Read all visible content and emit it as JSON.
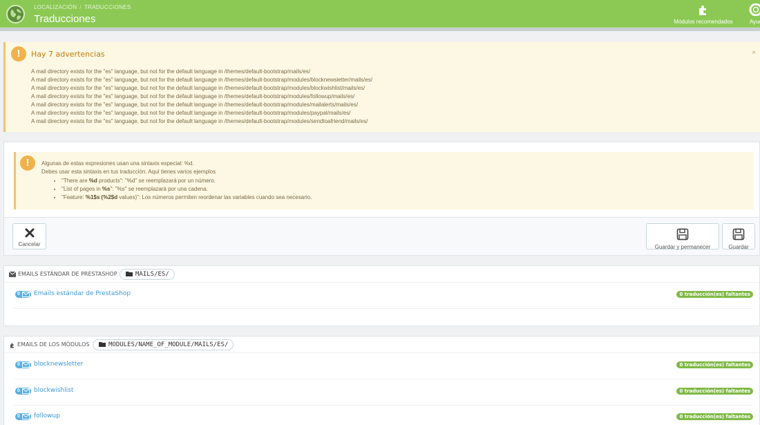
{
  "header": {
    "breadcrumb": [
      "LOCALIZACIÓN",
      "TRADUCCIONES"
    ],
    "breadcrumb_sep": "/",
    "title": "Traducciones",
    "actions": [
      {
        "label": "Módulos recomendados",
        "icon": "puzzle-icon"
      },
      {
        "label": "Ayud",
        "icon": "lifebuoy-icon"
      }
    ]
  },
  "warnings": {
    "title": "Hay 7 advertencias",
    "close": "×",
    "items": [
      "A mail directory exists for the \"es\" language, but not for the default language in /themes/default-bootstrap/mails/es/",
      "A mail directory exists for the \"es\" language, but not for the default language in /themes/default-bootstrap/modules/blocknewsletter/mails/es/",
      "A mail directory exists for the \"es\" language, but not for the default language in /themes/default-bootstrap/modules/blockwishlist/mails/es/",
      "A mail directory exists for the \"es\" language, but not for the default language in /themes/default-bootstrap/modules/followup/mails/es/",
      "A mail directory exists for the \"es\" language, but not for the default language in /themes/default-bootstrap/modules/mailalerts/mails/es/",
      "A mail directory exists for the \"es\" language, but not for the default language in /themes/default-bootstrap/modules/paypal/mails/es/",
      "A mail directory exists for the \"es\" language, but not for the default language in /themes/default-bootstrap/modules/sendtoafriend/mails/es/"
    ]
  },
  "info": {
    "line1": "Algunas de estas expresiones usan una sintaxis especial: %d.",
    "line2": "Debes usar esta sintaxis en tus traducción. Aquí tienes varios ejemplos",
    "examples": [
      {
        "pre": "\"There are ",
        "bold": "%d",
        "post": " products\": \"%d\" se reemplazará por un número."
      },
      {
        "pre": "\"List of pages in ",
        "bold": "%s",
        "post": "\": \"%s\" se reemplazará por una cadena."
      },
      {
        "pre": "\"Feature: ",
        "bold": "%1$s (%2$d",
        "post": " values)\": Los números permiten reordenar las variables cuando sea necesario."
      }
    ]
  },
  "toolbar": {
    "cancel": "Cancelar",
    "save_stay": "Guardar y permanecer",
    "save": "Guardar"
  },
  "sections": [
    {
      "title": "EMAILS ESTÁNDAR DE PRESTASHOP",
      "path": "MAILS/ES/",
      "rows": [
        {
          "count": "0",
          "label": "Emails estándar de PrestaShop",
          "missing": "0 traducción(es) faltantes"
        }
      ]
    },
    {
      "title": "EMAILS DE LOS MÓDULOS",
      "path": "MODULES/NAME_OF_MODULE/MAILS/ES/",
      "rows": [
        {
          "count": "0",
          "label": "blocknewsletter",
          "missing": "0 traducción(es) faltantes"
        },
        {
          "count": "0",
          "label": "blockwishlist",
          "missing": "0 traducción(es) faltantes"
        },
        {
          "count": "0",
          "label": "followup",
          "missing": "0 traducción(es) faltantes"
        }
      ]
    }
  ],
  "colors": {
    "header_green": "#8bc954",
    "warning_bg": "#fcf8e3",
    "link_blue": "#3d97d6",
    "badge_green": "#80b946",
    "count_blue": "#5aaee0"
  }
}
